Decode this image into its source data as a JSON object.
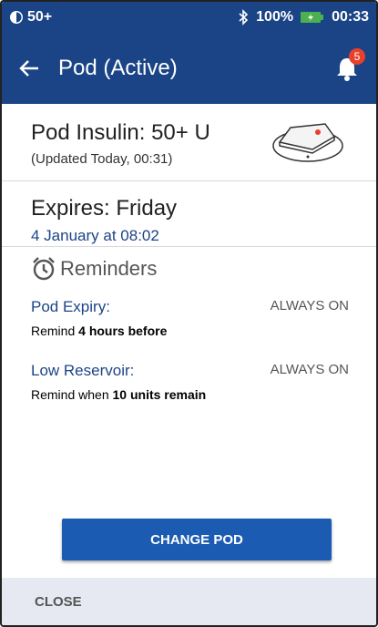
{
  "status_bar": {
    "left_text": "50+",
    "battery_percent": "100%",
    "time": "00:33"
  },
  "app_bar": {
    "title": "Pod (Active)",
    "notification_count": "5"
  },
  "insulin": {
    "label": "Pod Insulin: 50+ U",
    "updated": "(Updated Today, 00:31)"
  },
  "expires": {
    "label": "Expires: Friday",
    "date": "4 January at 08:02"
  },
  "reminders": {
    "heading": "Reminders",
    "items": [
      {
        "name": "Pod Expiry:",
        "state": "ALWAYS ON",
        "desc_prefix": "Remind ",
        "desc_bold": "4 hours before",
        "desc_suffix": ""
      },
      {
        "name": "Low Reservoir:",
        "state": "ALWAYS ON",
        "desc_prefix": "Remind when ",
        "desc_bold": "10 units remain",
        "desc_suffix": ""
      }
    ]
  },
  "change_pod_label": "CHANGE POD",
  "close_label": "CLOSE",
  "colors": {
    "primary": "#1b4486",
    "button": "#1b5bb2",
    "badge": "#e8412b",
    "battery": "#4caf50"
  }
}
